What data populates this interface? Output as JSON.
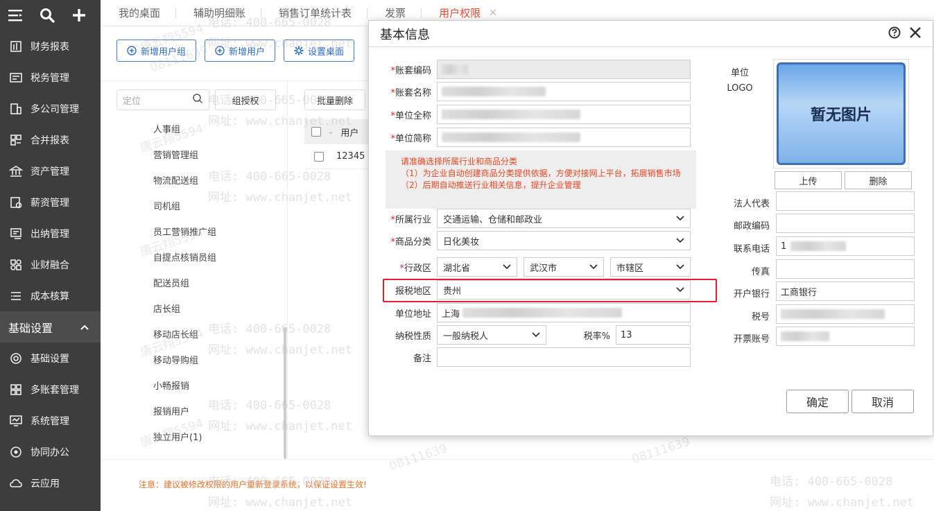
{
  "sidebar": {
    "top_icons": [
      "menu-icon",
      "search-icon",
      "plus-icon"
    ],
    "items_a": [
      {
        "label": "财务报表",
        "icon": "report-icon"
      },
      {
        "label": "税务管理",
        "icon": "tax-icon"
      },
      {
        "label": "多公司管理",
        "icon": "building-icon"
      },
      {
        "label": "合并报表",
        "icon": "merge-icon"
      },
      {
        "label": "资产管理",
        "icon": "bank-icon"
      },
      {
        "label": "薪资管理",
        "icon": "salary-icon"
      },
      {
        "label": "出纳管理",
        "icon": "cashier-icon"
      },
      {
        "label": "业财融合",
        "icon": "fusion-icon"
      },
      {
        "label": "成本核算",
        "icon": "cost-icon"
      }
    ],
    "section": "基础设置",
    "items_b": [
      {
        "label": "基础设置",
        "icon": "settings-icon"
      },
      {
        "label": "多账套管理",
        "icon": "accounts-icon"
      },
      {
        "label": "系统管理",
        "icon": "monitor-icon"
      },
      {
        "label": "协同办公",
        "icon": "collab-icon"
      },
      {
        "label": "云应用",
        "icon": "cloud-icon"
      }
    ]
  },
  "tabs": [
    "我的桌面",
    "辅助明细账",
    "销售订单统计表",
    "发票",
    "用户权限"
  ],
  "tab_close": "✕",
  "toolbar": {
    "add_group": "新增用户组",
    "add_user": "新增用户",
    "set_desktop": "设置桌面"
  },
  "left_panel": {
    "search_placeholder": "定位",
    "group_auth": "组授权",
    "groups": [
      "人事组",
      "营销管理组",
      "物流配送组",
      "司机组",
      "员工营销推广组",
      "自提点核销员组",
      "配送员组",
      "店长组",
      "移动店长组",
      "移动导购组",
      "小畅报销",
      "报销用户",
      "独立用户(1)"
    ]
  },
  "right_panel": {
    "batch_delete": "批量删除",
    "col_user": "用户",
    "row_value": "12345"
  },
  "notice": "注意：建议被修改权限的用户重新登录系统，以保证设置生效!",
  "watermark": {
    "phone": "电话: 400-665-0028",
    "site": "网址: www.chanjet.net",
    "name": "唐云翔5594",
    "code": "08111639"
  },
  "dialog": {
    "title": "基本信息",
    "fields": {
      "account_code": "账套编码",
      "account_name": "账套名称",
      "company_full": "单位全称",
      "company_short": "单位简称",
      "industry": "所属行业",
      "industry_value": "交通运输、仓储和邮政业",
      "category": "商品分类",
      "category_value": "日化美妆",
      "region": "行政区",
      "province": "湖北省",
      "city": "武汉市",
      "district": "市辖区",
      "tax_region": "报税地区",
      "tax_region_value": "贵州",
      "address": "单位地址",
      "address_value": "上海",
      "taxpayer_type": "纳税性质",
      "taxpayer_value": "一般纳税人",
      "tax_rate": "税率%",
      "tax_rate_value": "13",
      "remark": "备注"
    },
    "hint": {
      "line1": "请准确选择所属行业和商品分类",
      "line2": "（1）为企业自动创建商品分类提供依据，方便对接网上平台，拓展销售市场",
      "line3": "（2）后期自动推送行业相关信息，提升企业管理"
    },
    "logo": {
      "label_unit": "单位",
      "label_logo": "LOGO",
      "placeholder": "暂无图片",
      "upload": "上传",
      "delete": "删除"
    },
    "right_fields": {
      "legal_rep": "法人代表",
      "postal": "邮政编码",
      "phone": "联系电话",
      "phone_value": "1",
      "fax": "传真",
      "bank": "开户银行",
      "bank_value": "工商银行",
      "tax_no": "税号",
      "invoice_account": "开票账号"
    },
    "ok": "确定",
    "cancel": "取消"
  },
  "colors": {
    "sidebar_bg": "#3d3d3d",
    "accent_red": "#e84a33",
    "primary_blue": "#2b6ac8",
    "highlight_border": "#e0202b"
  }
}
